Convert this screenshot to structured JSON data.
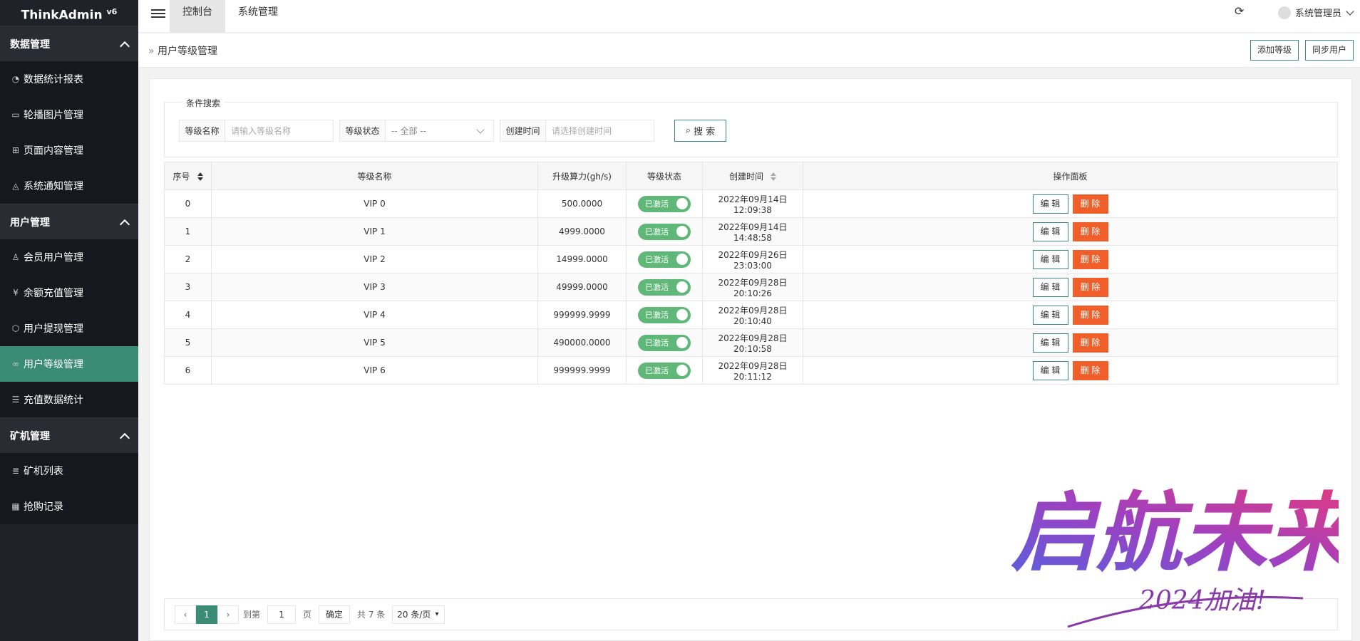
{
  "app": {
    "logo_text": "ThinkAdmin",
    "logo_version": "v6"
  },
  "sidebar": {
    "groups": [
      {
        "label": "数据管理",
        "items": [
          {
            "label": "数据统计报表",
            "icon": "dashboard-icon"
          },
          {
            "label": "轮播图片管理",
            "icon": "image-icon"
          },
          {
            "label": "页面内容管理",
            "icon": "book-icon"
          },
          {
            "label": "系统通知管理",
            "icon": "bell-icon"
          }
        ]
      },
      {
        "label": "用户管理",
        "items": [
          {
            "label": "会员用户管理",
            "icon": "user-icon"
          },
          {
            "label": "余额充值管理",
            "icon": "yen-icon"
          },
          {
            "label": "用户提现管理",
            "icon": "cube-icon"
          },
          {
            "label": "用户等级管理",
            "icon": "link-icon",
            "active": true
          },
          {
            "label": "充值数据统计",
            "icon": "sliders-icon"
          }
        ]
      },
      {
        "label": "矿机管理",
        "items": [
          {
            "label": "矿机列表",
            "icon": "list-icon"
          },
          {
            "label": "抢购记录",
            "icon": "calendar-icon"
          }
        ]
      }
    ]
  },
  "header": {
    "tabs": [
      "控制台",
      "系统管理"
    ],
    "active_tab": "控制台",
    "user_name": "系统管理员"
  },
  "breadcrumb": {
    "title": "用户等级管理",
    "add_button": "添加等级",
    "sync_button": "同步用户"
  },
  "search": {
    "legend": "条件搜索",
    "name_label": "等级名称",
    "name_placeholder": "请输入等级名称",
    "status_label": "等级状态",
    "status_value": "-- 全部 --",
    "time_label": "创建时间",
    "time_placeholder": "请选择创建时间",
    "search_button": "搜 索"
  },
  "table": {
    "columns": [
      "序号",
      "等级名称",
      "升级算力(gh/s)",
      "等级状态",
      "创建时间",
      "操作面板"
    ],
    "rows": [
      {
        "index": "0",
        "name": "VIP 0",
        "power": "500.0000",
        "status": "已激活",
        "time": "2022年09月14日 12:09:38"
      },
      {
        "index": "1",
        "name": "VIP 1",
        "power": "4999.0000",
        "status": "已激活",
        "time": "2022年09月14日 14:48:58"
      },
      {
        "index": "2",
        "name": "VIP 2",
        "power": "14999.0000",
        "status": "已激活",
        "time": "2022年09月26日 23:03:00"
      },
      {
        "index": "3",
        "name": "VIP 3",
        "power": "49999.0000",
        "status": "已激活",
        "time": "2022年09月28日 20:10:26"
      },
      {
        "index": "4",
        "name": "VIP 4",
        "power": "999999.9999",
        "status": "已激活",
        "time": "2022年09月28日 20:10:40"
      },
      {
        "index": "5",
        "name": "VIP 5",
        "power": "490000.0000",
        "status": "已激活",
        "time": "2022年09月28日 20:10:58"
      },
      {
        "index": "6",
        "name": "VIP 6",
        "power": "999999.9999",
        "status": "已激活",
        "time": "2022年09月28日 20:11:12"
      }
    ],
    "edit_label": "编 辑",
    "delete_label": "删 除"
  },
  "pagination": {
    "current_page": "1",
    "goto_label": "到第",
    "goto_value": "1",
    "page_suffix": "页",
    "confirm_label": "确定",
    "total_label": "共 7 条",
    "page_size": "20 条/页"
  },
  "watermark": {
    "main": "启航未来",
    "sub": "2024加油!"
  },
  "colors": {
    "sidebar_bg": "#20222a",
    "active_item": "#3a8d74",
    "switch_on": "#5fb878",
    "delete_btn": "#f05f2a"
  }
}
